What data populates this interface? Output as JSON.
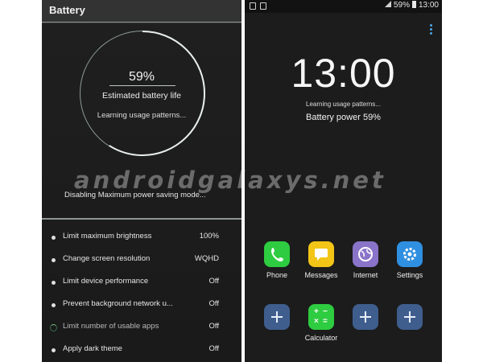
{
  "battery_screen": {
    "title": "Battery",
    "percentage": "59%",
    "ring_fill_fraction": 0.59,
    "estimated_label": "Estimated battery life",
    "learning_text": "Learning usage patterns...",
    "disabling_text": "Disabling Maximum power saving mode...",
    "settings": [
      {
        "label": "Limit maximum brightness",
        "value": "100%",
        "marker": "dot"
      },
      {
        "label": "Change screen resolution",
        "value": "WQHD",
        "marker": "dot"
      },
      {
        "label": "Limit device performance",
        "value": "Off",
        "marker": "dot"
      },
      {
        "label": "Prevent background network u...",
        "value": "Off",
        "marker": "dot"
      },
      {
        "label": "Limit number of usable apps",
        "value": "Off",
        "marker": "spinner"
      },
      {
        "label": "Apply dark theme",
        "value": "Off",
        "marker": "dot"
      }
    ]
  },
  "home_screen": {
    "status_bar": {
      "battery": "59%",
      "time": "13:00"
    },
    "clock": "13:00",
    "learning_text": "Learning usage patterns...",
    "battery_power": "Battery power 59%",
    "apps_row1": [
      {
        "name": "Phone",
        "color": "#2ecc40"
      },
      {
        "name": "Messages",
        "color": "#f2c516"
      },
      {
        "name": "Internet",
        "color": "#8a74c9"
      },
      {
        "name": "Settings",
        "color": "#2f8fe0"
      }
    ],
    "apps_row2": [
      {
        "name": "",
        "type": "add"
      },
      {
        "name": "Calculator",
        "color": "#2ecc40",
        "type": "app"
      },
      {
        "name": "",
        "type": "add"
      },
      {
        "name": "",
        "type": "add"
      }
    ]
  },
  "watermark": "androidgalaxys.net",
  "colors": {
    "accent_blue": "#4aa6e8",
    "add_tile": "#3f5e8e"
  }
}
